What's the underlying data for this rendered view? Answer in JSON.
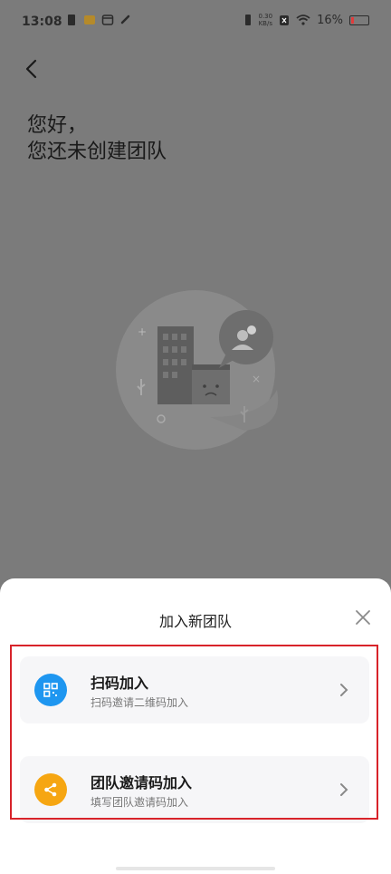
{
  "status_bar": {
    "time": "13:08",
    "net_speed_value": "0.30",
    "net_speed_unit": "KB/s",
    "battery_percent": "16%",
    "battery_level": 0.16
  },
  "page": {
    "greeting_line1": "您好，",
    "greeting_line2": "您还未创建团队"
  },
  "sheet": {
    "title": "加入新团队",
    "options": [
      {
        "title": "扫码加入",
        "subtitle": "扫码邀请二维码加入",
        "icon": "qr-code-icon",
        "color": "#1e96f0"
      },
      {
        "title": "团队邀请码加入",
        "subtitle": "填写团队邀请码加入",
        "icon": "share-icon",
        "color": "#f6a612"
      }
    ]
  },
  "colors": {
    "overlay": "#7b7b7b",
    "highlight": "#d8232a"
  }
}
